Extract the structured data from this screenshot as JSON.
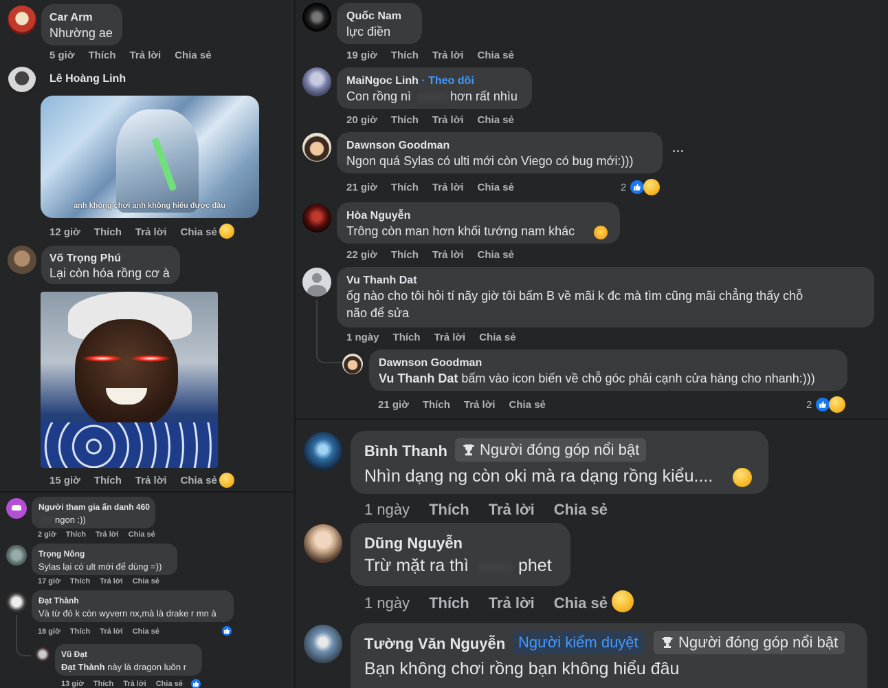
{
  "panel_a": {
    "comments": [
      {
        "name": "Car Arm",
        "text": "Nhường ae",
        "time": "5 giờ"
      },
      {
        "name": "Lê Hoàng Linh",
        "time": "12 giờ",
        "image_caption": "anh không chơi anh không hiểu được đâu"
      },
      {
        "name": "Võ Trọng Phú",
        "text": "Lại còn hóa rồng cơ à",
        "time": "15 giờ"
      }
    ]
  },
  "panel_b": {
    "comments": [
      {
        "name": "Người tham gia ẩn danh 460",
        "text": "ngon :))",
        "time": "2 giờ"
      },
      {
        "name": "Trọng Nông",
        "text": "Sylas lại có ult mới để dùng =))",
        "time": "17 giờ"
      },
      {
        "name": "Đạt Thành",
        "text": "Và từ đó k còn wyvern nx,mà là drake r mn à",
        "time": "18 giờ"
      },
      {
        "name": "Vũ Đạt",
        "mention": "Đạt Thành",
        "text": " này là dragon luôn r",
        "time": "13 giờ"
      }
    ]
  },
  "panel_c": {
    "comments": [
      {
        "name": "Quốc Nam",
        "text": "lực điền",
        "time": "19 giờ"
      },
      {
        "name": "MaiNgoc Linh",
        "follow": "· Theo dõi",
        "text_a": "Con rồng nì",
        "text_b": "hơn rất nhìu",
        "time": "20 giờ"
      },
      {
        "name": "Dawnson Goodman",
        "text": "Ngon quá Sylas có ulti mới còn Viego có bug mới:)))",
        "time": "21 giờ",
        "reaction_count": "2",
        "more": "···"
      },
      {
        "name": "Hòa Nguyễn",
        "text": "Trông còn man hơn khối tướng nam khác",
        "time": "22 giờ"
      },
      {
        "name": "Vu Thanh Dat",
        "text_line1": "ốg nào cho tôi hỏi tí nãy giờ tôi bấm B về mãi k đc mà tìm cũng mãi chẳng thấy chỗ",
        "text_line2": "não để sửa",
        "time": "1 ngày"
      },
      {
        "name": "Dawnson Goodman",
        "mention": "Vu Thanh Dat",
        "text": " bấm vào icon biến về chỗ góc phải cạnh cửa hàng cho nhanh:)))",
        "time": "21 giờ",
        "reaction_count": "2"
      }
    ]
  },
  "panel_d": {
    "comments": [
      {
        "name": "Bình Thanh",
        "badge_top": "Người đóng góp nổi bật",
        "text": "Nhìn dạng ng còn oki mà ra dạng rồng kiểu....",
        "time": "1 ngày"
      },
      {
        "name": "Dũng Nguyễn",
        "text_a": "Trừ mặt ra thì",
        "text_b": "phet",
        "time": "1 ngày"
      },
      {
        "name": "Tường Văn Nguyễn",
        "badge_mod": "Người kiểm duyệt",
        "badge_top": "Người đóng góp nổi bật",
        "text": "Bạn không chơi rồng bạn không hiểu đâu"
      }
    ]
  },
  "actions": {
    "like": "Thích",
    "reply": "Trả lời",
    "share": "Chia sẻ"
  },
  "icons": {
    "like": "like-icon",
    "haha": "haha-emoji-icon",
    "wow": "wow-emoji-icon",
    "trophy": "trophy-icon",
    "more": "more-options-icon"
  },
  "colors": {
    "background": "#18191a",
    "panel": "#242526",
    "bubble": "#3a3b3c",
    "text": "#e4e6eb",
    "secondary": "#b0b3b8",
    "link": "#4599ff",
    "like_blue": "#1877f2"
  }
}
